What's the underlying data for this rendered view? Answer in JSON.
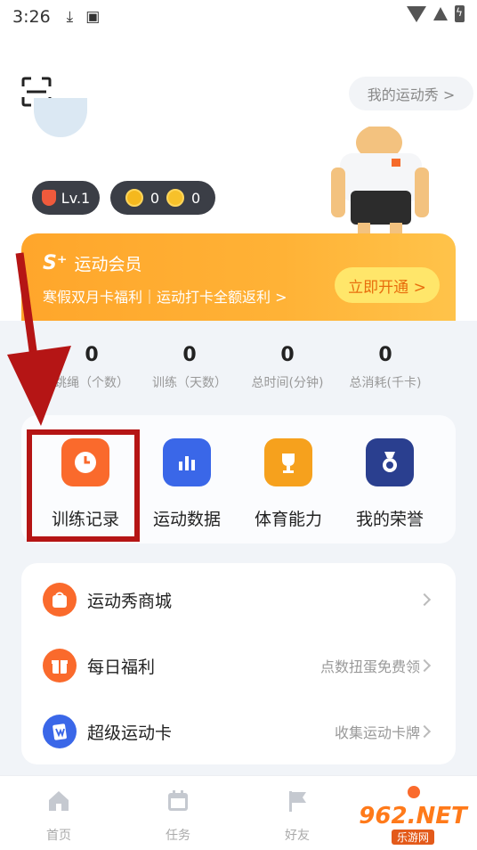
{
  "status_bar": {
    "time": "3:26"
  },
  "header": {
    "show_link": "我的运动秀 >"
  },
  "profile": {
    "level": "Lv.1",
    "coins": "0",
    "energy": "0"
  },
  "vip": {
    "title": "运动会员",
    "logo": "S⁺",
    "subtitle": "寒假双月卡福利｜运动打卡全额返利 >",
    "button": "立即开通 >"
  },
  "stats": [
    {
      "value": "0",
      "label": "跳绳（个数）"
    },
    {
      "value": "0",
      "label": "训练（天数）"
    },
    {
      "value": "0",
      "label": "总时间(分钟)"
    },
    {
      "value": "0",
      "label": "总消耗(千卡)"
    }
  ],
  "shortcuts": [
    {
      "label": "训练记录",
      "icon": "clock-icon"
    },
    {
      "label": "运动数据",
      "icon": "bar-chart-icon"
    },
    {
      "label": "体育能力",
      "icon": "trophy-icon"
    },
    {
      "label": "我的荣誉",
      "icon": "medal-icon"
    }
  ],
  "menu": [
    {
      "label": "运动秀商城",
      "hint": "",
      "icon": "shop-bag-icon"
    },
    {
      "label": "每日福利",
      "hint": "点数扭蛋免费领",
      "icon": "gift-icon"
    },
    {
      "label": "超级运动卡",
      "hint": "收集运动卡牌",
      "icon": "card-icon"
    }
  ],
  "tabs": [
    {
      "label": "首页",
      "icon": "home-icon"
    },
    {
      "label": "任务",
      "icon": "calendar-icon"
    },
    {
      "label": "好友",
      "icon": "flag-icon"
    }
  ],
  "watermark": {
    "big": "962.NET",
    "small": "乐游网"
  },
  "colors": {
    "accent": "#fa6a2c",
    "vip": "#ffa62b",
    "annotation": "#b51515"
  }
}
